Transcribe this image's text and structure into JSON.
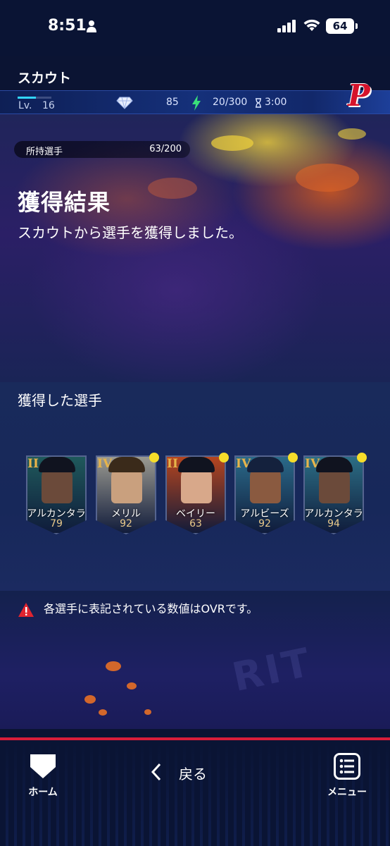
{
  "status_bar": {
    "time": "8:51",
    "battery": "64"
  },
  "header": {
    "title": "スカウト"
  },
  "resources": {
    "level_label": "Lv.",
    "level": "16",
    "level_progress": 0.55,
    "diamonds": "85",
    "stamina": "20/300",
    "timer": "3:00",
    "team_logo": "P"
  },
  "result": {
    "owned_label": "所持選手",
    "owned_value": "63/200",
    "title": "獲得結果",
    "subtitle": "スカウトから選手を獲得しました。"
  },
  "acquired": {
    "heading": "獲得した選手",
    "cards": [
      {
        "rank": "II",
        "name": "アルカンタラ",
        "ovr": "79",
        "new": false,
        "theme": "#1f5a5c"
      },
      {
        "rank": "IV",
        "name": "メリル",
        "ovr": "92",
        "new": true,
        "theme": "#9d9c92"
      },
      {
        "rank": "II",
        "name": "ベイリー",
        "ovr": "63",
        "new": true,
        "theme": "#b8461f"
      },
      {
        "rank": "IV",
        "name": "アルビーズ",
        "ovr": "92",
        "new": true,
        "theme": "#2b6b8a"
      },
      {
        "rank": "IV",
        "name": "アルカンタラ",
        "ovr": "94",
        "new": true,
        "theme": "#2c6f86"
      }
    ]
  },
  "notice": {
    "text": "各選手に表記されている数値はOVRです。"
  },
  "watermark": "RIT",
  "bottom_nav": {
    "home_label": "ホーム",
    "back_label": "戻る",
    "menu_label": "メニュー"
  },
  "colors": {
    "accent_red": "#d81e3a",
    "rank_gold": "#e7b44a",
    "new_dot": "#f6dd2a"
  }
}
